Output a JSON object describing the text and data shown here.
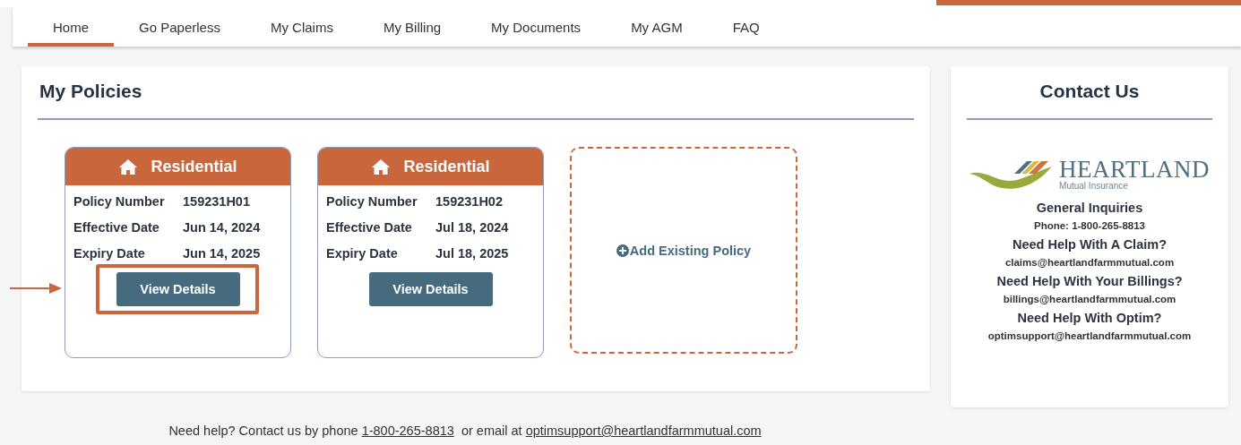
{
  "nav": {
    "tabs": [
      {
        "label": "Home",
        "selected": true
      },
      {
        "label": "Go Paperless",
        "selected": false
      },
      {
        "label": "My Claims",
        "selected": false
      },
      {
        "label": "My Billing",
        "selected": false
      },
      {
        "label": "My Documents",
        "selected": false
      },
      {
        "label": "My AGM",
        "selected": false
      },
      {
        "label": "FAQ",
        "selected": false
      }
    ]
  },
  "policies": {
    "title": "My Policies",
    "cards": [
      {
        "type": "Residential",
        "highlighted": true,
        "fields": [
          {
            "label": "Policy Number",
            "value": "159231H01"
          },
          {
            "label": "Effective Date",
            "value": "Jun 14, 2024"
          },
          {
            "label": "Expiry Date",
            "value": "Jun 14, 2025"
          }
        ],
        "button": "View Details"
      },
      {
        "type": "Residential",
        "highlighted": false,
        "fields": [
          {
            "label": "Policy Number",
            "value": "159231H02"
          },
          {
            "label": "Effective Date",
            "value": "Jul 18, 2024"
          },
          {
            "label": "Expiry Date",
            "value": "Jul 18, 2025"
          }
        ],
        "button": "View Details"
      }
    ],
    "add_button": "Add Existing Policy"
  },
  "contact": {
    "title": "Contact Us",
    "logo": {
      "name": "HEARTLAND",
      "tagline": "Mutual Insurance"
    },
    "items": [
      {
        "kind": "heading",
        "text": "General Inquiries"
      },
      {
        "kind": "text",
        "text": "Phone: 1-800-265-8813"
      },
      {
        "kind": "heading",
        "text": "Need Help With A Claim?"
      },
      {
        "kind": "text",
        "text": "claims@heartlandfarmmutual.com"
      },
      {
        "kind": "heading",
        "text": "Need Help With Your Billings?"
      },
      {
        "kind": "text",
        "text": "billings@heartlandfarmmutual.com"
      },
      {
        "kind": "heading",
        "text": "Need Help With Optim?"
      },
      {
        "kind": "text",
        "text": "optimsupport@heartlandfarmmutual.com"
      }
    ]
  },
  "footer": {
    "before": "Need help? Contact us by phone",
    "phone": "1-800-265-8813",
    "middle": "or email at",
    "email": "optimsupport@heartlandfarmmutual.com"
  }
}
